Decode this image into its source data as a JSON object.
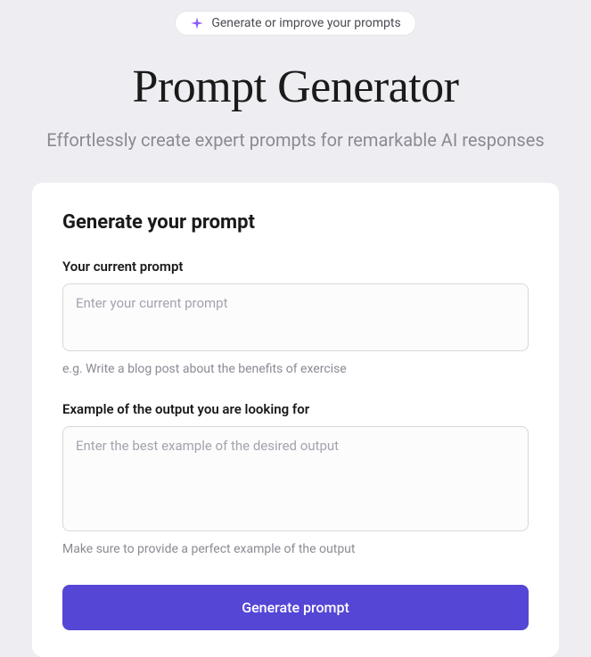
{
  "badge": {
    "label": "Generate or improve your prompts"
  },
  "header": {
    "title": "Prompt Generator",
    "subtitle": "Effortlessly create expert prompts for remarkable AI responses"
  },
  "form": {
    "heading": "Generate your prompt",
    "current_prompt": {
      "label": "Your current prompt",
      "placeholder": "Enter your current prompt",
      "value": "",
      "helper": "e.g. Write a blog post about the benefits of exercise"
    },
    "example_output": {
      "label": "Example of the output you are looking for",
      "placeholder": "Enter the best example of the desired output",
      "value": "",
      "helper": "Make sure to provide a perfect example of the output"
    },
    "submit_label": "Generate prompt"
  },
  "colors": {
    "accent": "#5546d6",
    "sparkle": "#8b5cf6"
  }
}
